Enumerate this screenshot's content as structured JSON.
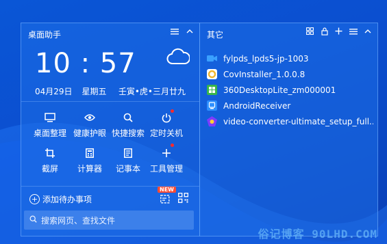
{
  "left_panel": {
    "title": "桌面助手",
    "clock": {
      "time": "10 : 57"
    },
    "date": {
      "day": "04月29日",
      "weekday": "星期五",
      "lunar": "壬寅•虎•三月廿九"
    },
    "tools_row1": [
      {
        "label": "桌面整理",
        "icon": "monitor-icon"
      },
      {
        "label": "健康护眼",
        "icon": "eye-icon"
      },
      {
        "label": "快捷搜索",
        "icon": "search-icon"
      },
      {
        "label": "定时关机",
        "icon": "power-icon"
      }
    ],
    "tools_row2": [
      {
        "label": "截屏",
        "icon": "crop-icon"
      },
      {
        "label": "计算器",
        "icon": "calculator-icon"
      },
      {
        "label": "记事本",
        "icon": "notepad-icon"
      },
      {
        "label": "工具管理",
        "icon": "plus-icon"
      }
    ],
    "todo_label": "添加待办事项",
    "new_badge": "NEW",
    "search_placeholder": "搜索网页、查找文件"
  },
  "right_panel": {
    "title": "其它",
    "files": [
      {
        "name": "fylpds_lpds5-jp-1003",
        "icon": "video-camera-icon",
        "color": "#3aa0ff"
      },
      {
        "name": "CovInstaller_1.0.0.8",
        "icon": "installer-icon",
        "color": "#f2b62e"
      },
      {
        "name": "360DesktopLite_zm000001",
        "icon": "360-desktop-icon",
        "color": "#39b54a"
      },
      {
        "name": "AndroidReceiver",
        "icon": "android-receiver-icon",
        "color": "#2e8fff"
      },
      {
        "name": "video-converter-ultimate_setup_full...",
        "icon": "converter-setup-icon",
        "color": "#7d3cff"
      }
    ]
  },
  "watermark": "俗记博客 90LHD.COM"
}
